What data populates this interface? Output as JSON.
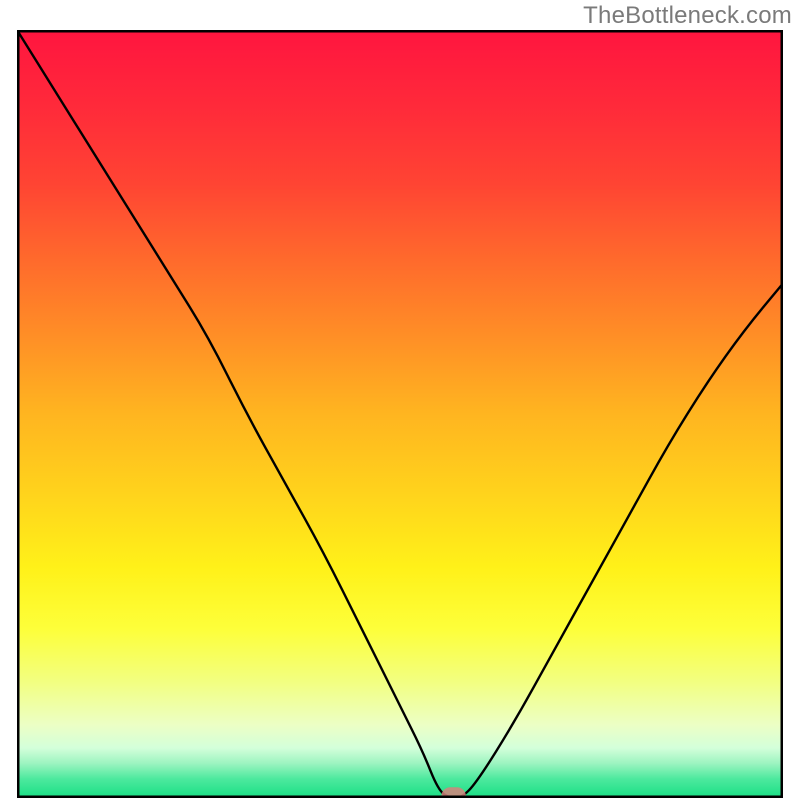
{
  "watermark": "TheBottleneck.com",
  "gradient_stops": [
    {
      "offset": 0.0,
      "color": "#ff153f"
    },
    {
      "offset": 0.1,
      "color": "#ff2a3a"
    },
    {
      "offset": 0.2,
      "color": "#ff4433"
    },
    {
      "offset": 0.3,
      "color": "#ff6a2c"
    },
    {
      "offset": 0.4,
      "color": "#ff8f26"
    },
    {
      "offset": 0.5,
      "color": "#ffb520"
    },
    {
      "offset": 0.6,
      "color": "#ffd21c"
    },
    {
      "offset": 0.7,
      "color": "#fff119"
    },
    {
      "offset": 0.78,
      "color": "#fdff3a"
    },
    {
      "offset": 0.85,
      "color": "#f2ff82"
    },
    {
      "offset": 0.905,
      "color": "#ecffc5"
    },
    {
      "offset": 0.935,
      "color": "#d3ffda"
    },
    {
      "offset": 0.955,
      "color": "#9cf4c0"
    },
    {
      "offset": 0.975,
      "color": "#4de99e"
    },
    {
      "offset": 1.0,
      "color": "#18df84"
    }
  ],
  "chart_data": {
    "type": "line",
    "title": "",
    "xlabel": "",
    "ylabel": "",
    "xlim": [
      0,
      100
    ],
    "ylim": [
      0,
      100
    ],
    "legend": false,
    "grid": false,
    "series": [
      {
        "name": "bottleneck_curve",
        "x": [
          0,
          5,
          10,
          15,
          20,
          25,
          30,
          35,
          40,
          45,
          50,
          53,
          55,
          56.5,
          58,
          60,
          65,
          70,
          75,
          80,
          85,
          90,
          95,
          100
        ],
        "y": [
          100,
          92,
          84,
          76,
          68,
          60,
          50,
          41,
          32,
          22,
          12,
          6,
          1,
          0,
          0,
          2,
          10,
          19,
          28,
          37,
          46,
          54,
          61,
          67
        ]
      }
    ],
    "marker": {
      "x": 57,
      "y": 0,
      "width_pct": 3.2,
      "height_pct": 2.3
    }
  }
}
